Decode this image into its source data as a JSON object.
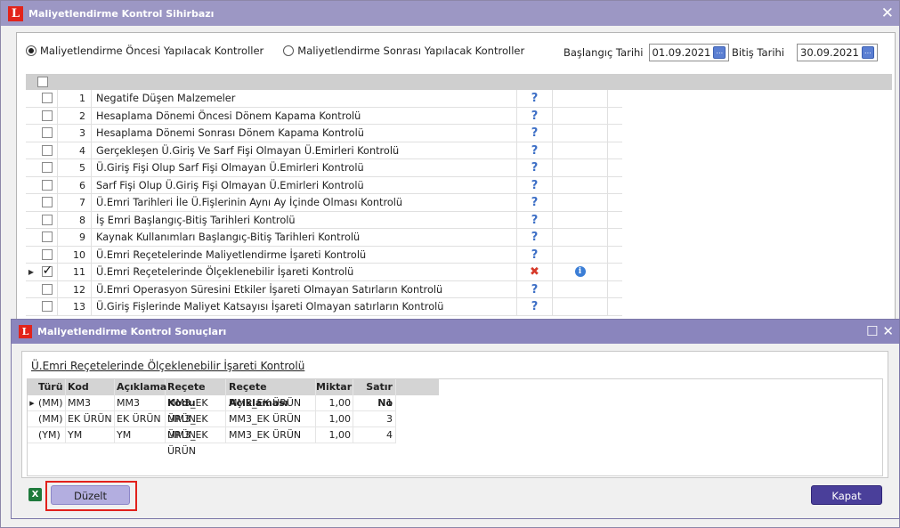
{
  "main_window": {
    "title": "Maliyetlendirme Kontrol Sihirbazı",
    "close_glyph": "✕",
    "radio_before": "Maliyetlendirme Öncesi Yapılacak Kontroller",
    "radio_after": "Maliyetlendirme Sonrası Yapılacak Kontroller",
    "start_label": "Başlangıç Tarihi",
    "start_value": "01.09.2021",
    "end_label": "Bitiş Tarihi",
    "end_value": "30.09.2021",
    "date_btn": "...",
    "rows": [
      {
        "no": "1",
        "name": "Negatife Düşen Malzemeler",
        "status": "?",
        "checked": false
      },
      {
        "no": "2",
        "name": "Hesaplama Dönemi Öncesi Dönem Kapama Kontrolü",
        "status": "?",
        "checked": false
      },
      {
        "no": "3",
        "name": "Hesaplama Dönemi Sonrası Dönem Kapama Kontrolü",
        "status": "?",
        "checked": false
      },
      {
        "no": "4",
        "name": "Gerçekleşen Ü.Giriş Ve Sarf Fişi Olmayan Ü.Emirleri Kontrolü",
        "status": "?",
        "checked": false
      },
      {
        "no": "5",
        "name": "Ü.Giriş Fişi Olup Sarf Fişi Olmayan Ü.Emirleri Kontrolü",
        "status": "?",
        "checked": false
      },
      {
        "no": "6",
        "name": "Sarf Fişi Olup Ü.Giriş Fişi Olmayan Ü.Emirleri Kontrolü",
        "status": "?",
        "checked": false
      },
      {
        "no": "7",
        "name": "Ü.Emri Tarihleri İle Ü.Fişlerinin Aynı Ay İçinde Olması Kontrolü",
        "status": "?",
        "checked": false
      },
      {
        "no": "8",
        "name": "İş Emri Başlangıç-Bitiş Tarihleri Kontrolü",
        "status": "?",
        "checked": false
      },
      {
        "no": "9",
        "name": "Kaynak Kullanımları Başlangıç-Bitiş Tarihleri Kontrolü",
        "status": "?",
        "checked": false
      },
      {
        "no": "10",
        "name": "Ü.Emri Reçetelerinde Maliyetlendirme İşareti Kontrolü",
        "status": "?",
        "checked": false
      },
      {
        "no": "11",
        "name": "Ü.Emri Reçetelerinde Ölçeklenebilir İşareti Kontrolü",
        "status": "✖",
        "checked": true,
        "info": "i"
      },
      {
        "no": "12",
        "name": "Ü.Emri Operasyon Süresini Etkiler İşareti Olmayan Satırların Kontrolü",
        "status": "?",
        "checked": false
      },
      {
        "no": "13",
        "name": "Ü.Giriş Fişlerinde Maliyet Katsayısı İşareti Olmayan satırların Kontrolü",
        "status": "?",
        "checked": false
      }
    ]
  },
  "dialog": {
    "title": "Maliyetlendirme Kontrol Sonuçları",
    "maximize_glyph": "☐",
    "close_glyph": "✕",
    "subtitle": "Ü.Emri Reçetelerinde Ölçeklenebilir İşareti Kontrolü",
    "columns": [
      "Türü",
      "Kod",
      "Açıklama",
      "Reçete Kodu",
      "Reçete Açıklaması",
      "Miktar",
      "Satır No"
    ],
    "rows": [
      [
        "(MM)",
        "MM3",
        "MM3",
        "MM3_EK ÜRÜN",
        "MM3_EK ÜRÜN",
        "1,00",
        "1"
      ],
      [
        "(MM)",
        "EK ÜRÜN",
        "EK ÜRÜN",
        "MM3_EK ÜRÜN",
        "MM3_EK ÜRÜN",
        "1,00",
        "3"
      ],
      [
        "(YM)",
        "YM",
        "YM",
        "MM3_EK ÜRÜN",
        "MM3_EK ÜRÜN",
        "1,00",
        "4"
      ]
    ],
    "excel_glyph": "X",
    "fix_button": "Düzelt",
    "close_button": "Kapat"
  }
}
